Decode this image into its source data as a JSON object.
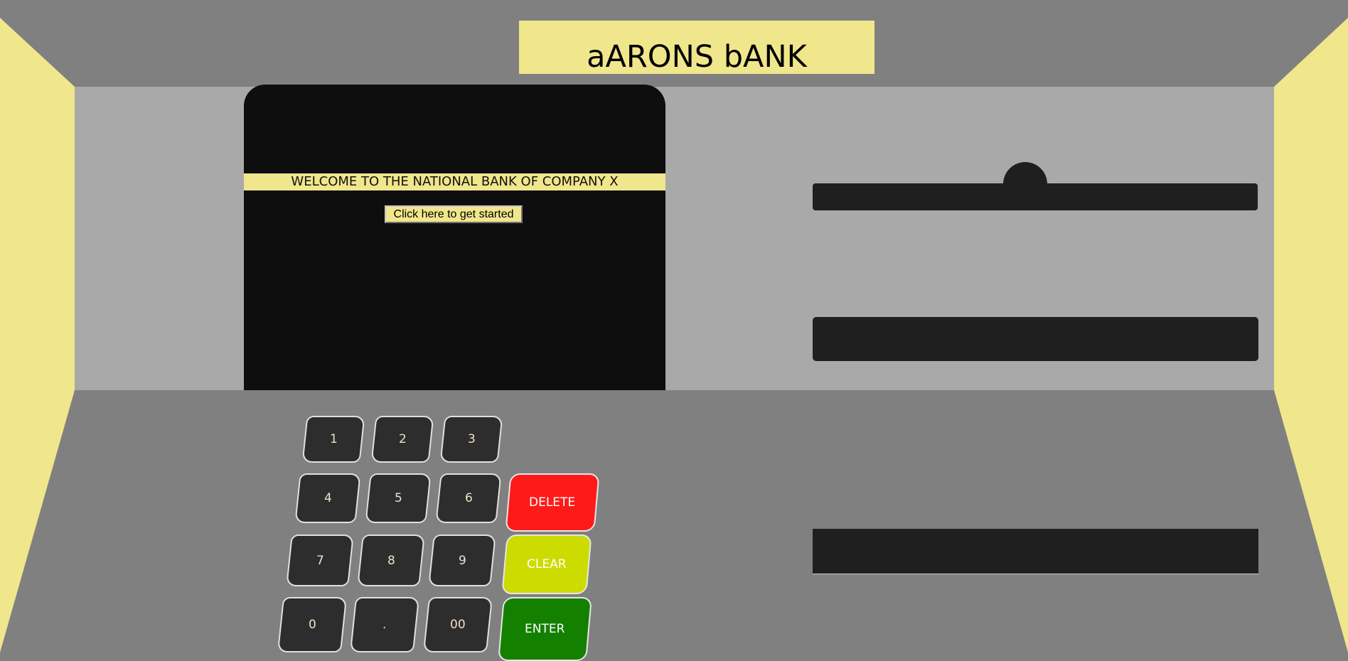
{
  "bank_name": "aARONS bANK",
  "screen": {
    "welcome_text": "WELCOME TO THE NATIONAL BANK OF COMPANY X",
    "start_button": "Click here to get started"
  },
  "keypad": {
    "keys": [
      "1",
      "2",
      "3",
      "4",
      "5",
      "6",
      "7",
      "8",
      "9",
      "0",
      ".",
      "00"
    ],
    "delete_label": "DELETE",
    "clear_label": "CLEAR",
    "enter_label": "ENTER"
  },
  "colors": {
    "sign_and_walls": "#f0e68c",
    "screen": "#0e0e0e",
    "delete": "#ff1a1a",
    "clear": "#cddc00",
    "enter": "#138000"
  }
}
